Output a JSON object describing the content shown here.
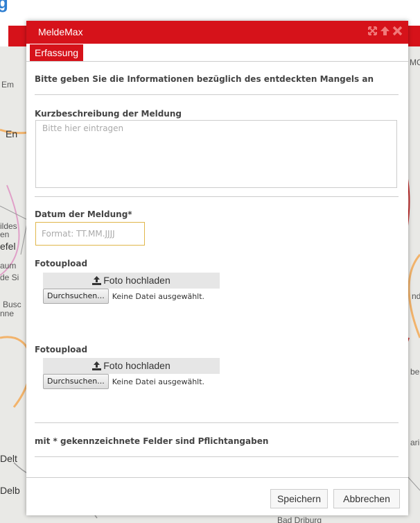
{
  "colors": {
    "brand_red": "#d6121a",
    "heading_blue": "#2f7fd1",
    "focus_border": "#e0b64a"
  },
  "app": {
    "heading_fragment": "g"
  },
  "map": {
    "labels": [
      "Em",
      "En",
      "efel",
      "ildes",
      "en",
      "aum",
      "de Si",
      "Busc",
      "nne",
      "Delt",
      "Delb",
      "MC",
      "nd",
      "berg",
      "arie",
      "Bad Driburg"
    ]
  },
  "dialog": {
    "title": "MeldeMax",
    "title_icons": [
      "expand-icon",
      "collapse-icon",
      "close-icon"
    ],
    "tab_label": "Erfassung",
    "intro": "Bitte geben Sie die Informationen bezüglich des entdeckten Mangels an",
    "description": {
      "label": "Kurzbeschreibung der Meldung",
      "placeholder": "Bitte hier eintragen",
      "value": ""
    },
    "date": {
      "label": "Datum der Meldung*",
      "placeholder": "Format: TT.MM.JJJJ",
      "value": ""
    },
    "uploads": [
      {
        "label": "Fotoupload",
        "button": "Foto hochladen",
        "browse": "Durchsuchen...",
        "status": "Keine Datei ausgewählt."
      },
      {
        "label": "Fotoupload",
        "button": "Foto hochladen",
        "browse": "Durchsuchen...",
        "status": "Keine Datei ausgewählt."
      }
    ],
    "required_note": "mit * gekennzeichnete Felder sind Pflichtangaben",
    "save_label": "Speichern",
    "cancel_label": "Abbrechen"
  }
}
